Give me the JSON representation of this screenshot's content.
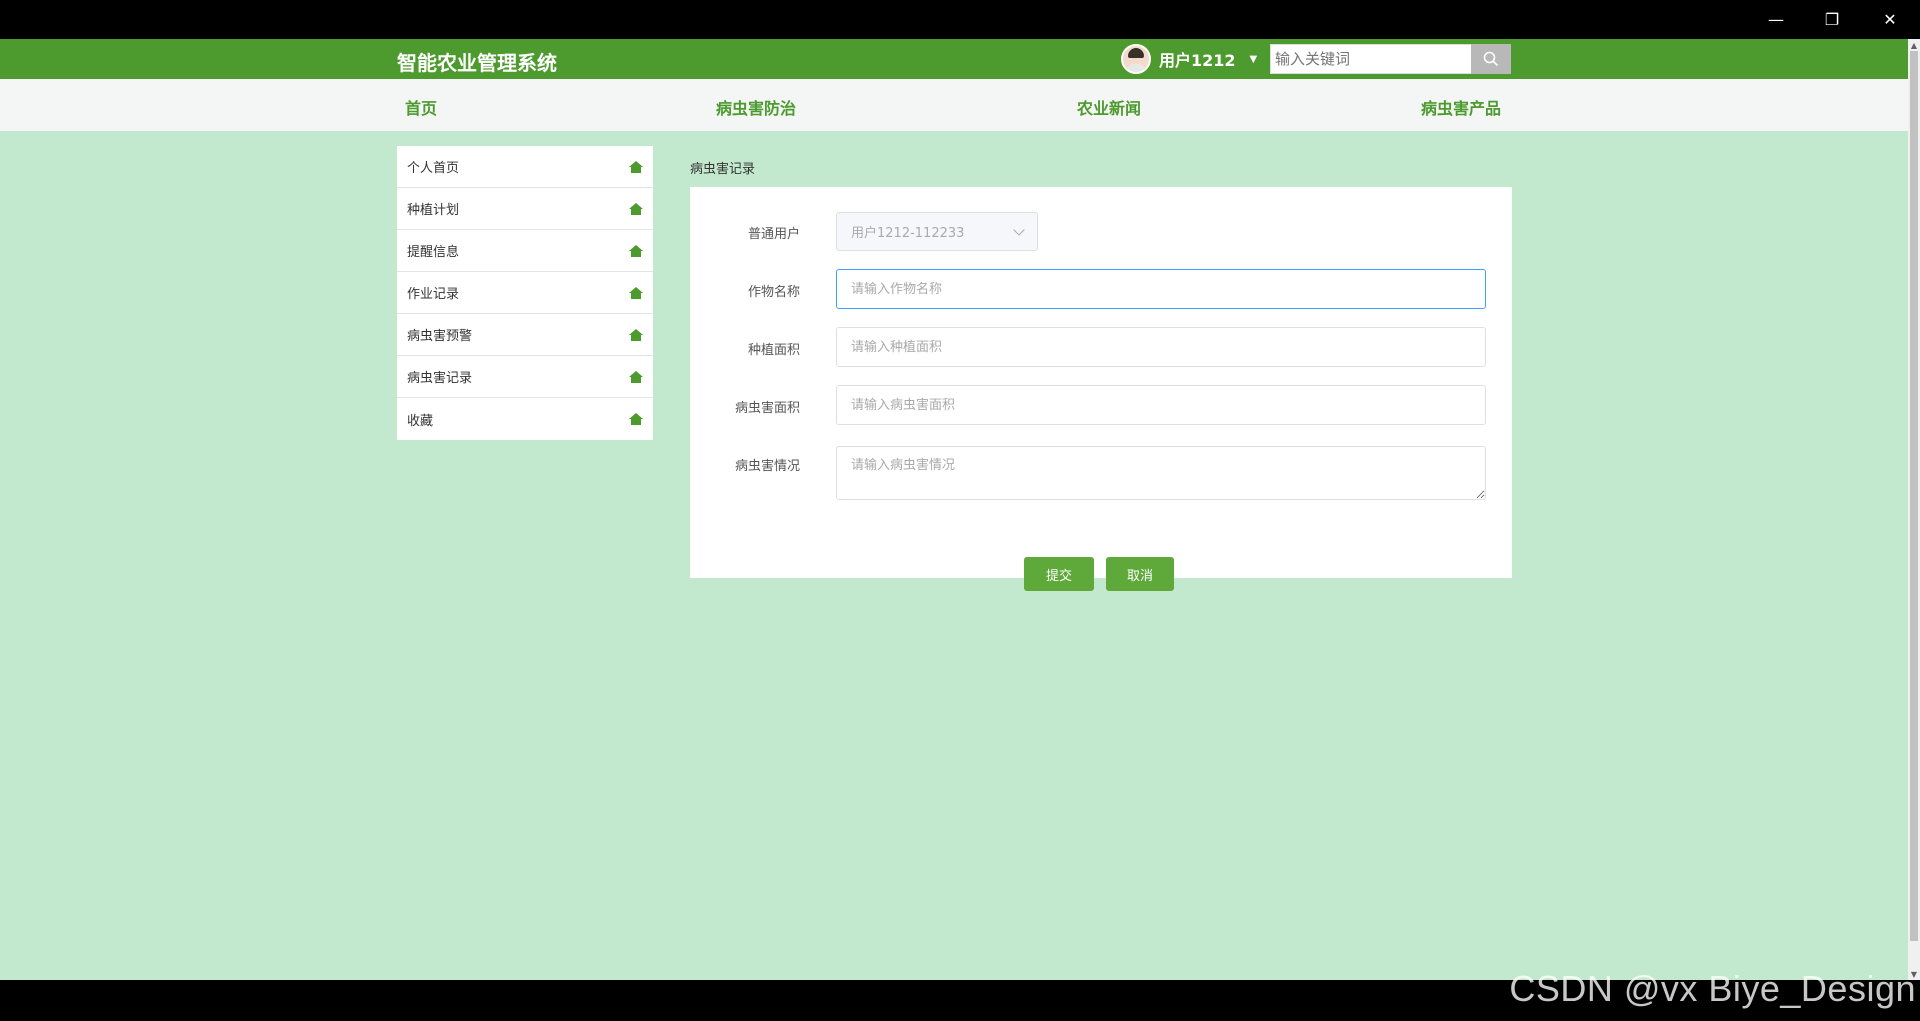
{
  "window": {
    "minimize": "—",
    "restore": "❐",
    "close": "✕"
  },
  "header": {
    "app_title": "智能农业管理系统",
    "username": "用户1212",
    "search_placeholder": "输入关键词"
  },
  "nav": {
    "items": [
      {
        "label": "首页"
      },
      {
        "label": "病虫害防治"
      },
      {
        "label": "农业新闻"
      },
      {
        "label": "病虫害产品"
      }
    ]
  },
  "sidebar": {
    "items": [
      {
        "label": "个人首页",
        "icon": "home-icon"
      },
      {
        "label": "种植计划",
        "icon": "home-icon"
      },
      {
        "label": "提醒信息",
        "icon": "home-icon"
      },
      {
        "label": "作业记录",
        "icon": "home-icon"
      },
      {
        "label": "病虫害预警",
        "icon": "home-icon"
      },
      {
        "label": "病虫害记录",
        "icon": "home-icon"
      },
      {
        "label": "收藏",
        "icon": "home-icon"
      }
    ]
  },
  "breadcrumb": "病虫害记录",
  "form": {
    "user_label": "普通用户",
    "user_value": "用户1212-112233",
    "crop_label": "作物名称",
    "crop_placeholder": "请输入作物名称",
    "area_label": "种植面积",
    "area_placeholder": "请输入种植面积",
    "pest_area_label": "病虫害面积",
    "pest_area_placeholder": "请输入病虫害面积",
    "pest_situation_label": "病虫害情况",
    "pest_situation_placeholder": "请输入病虫害情况",
    "submit": "提交",
    "cancel": "取消"
  },
  "watermark": "CSDN @vx Biye_Design",
  "colors": {
    "header_green": "#4d9a2e",
    "page_bg": "#c2e8cd",
    "button_green": "#5fa93a"
  }
}
